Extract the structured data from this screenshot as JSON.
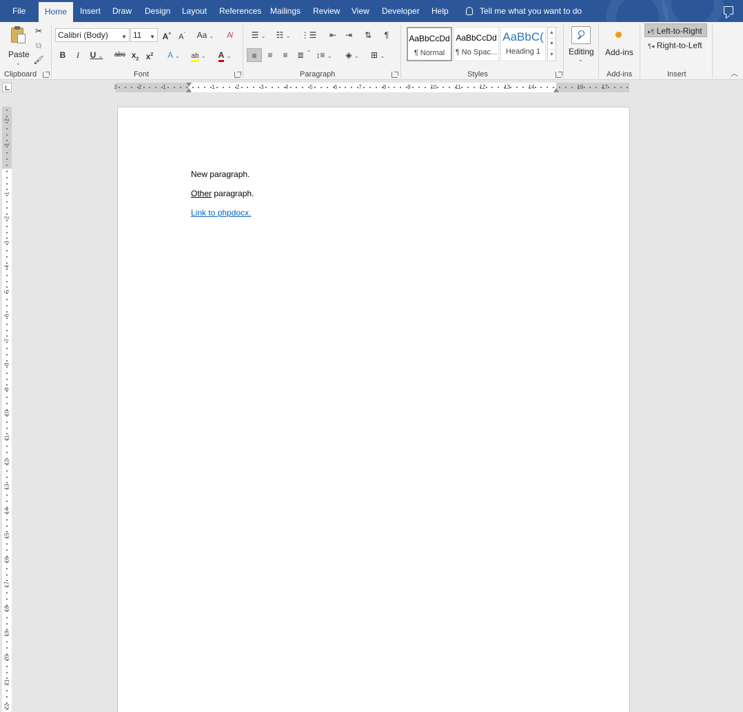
{
  "tabs": {
    "file": "File",
    "home": "Home",
    "insert": "Insert",
    "draw": "Draw",
    "design": "Design",
    "layout": "Layout",
    "references": "References",
    "mailings": "Mailings",
    "review": "Review",
    "view": "View",
    "developer": "Developer",
    "help": "Help"
  },
  "tell_me": "Tell me what you want to do",
  "clipboard": {
    "paste_label": "Paste",
    "group_label": "Clipboard"
  },
  "font": {
    "family": "Calibri (Body)",
    "size": "11",
    "group_label": "Font"
  },
  "paragraph": {
    "group_label": "Paragraph"
  },
  "styles": {
    "group_label": "Styles",
    "items": [
      {
        "preview": "AaBbCcDd",
        "name": "¶ Normal"
      },
      {
        "preview": "AaBbCcDd",
        "name": "¶ No Spac..."
      },
      {
        "preview": "AaBbC(",
        "name": "Heading 1"
      }
    ]
  },
  "editing": {
    "label": "Editing"
  },
  "addins": {
    "label": "Add-ins",
    "group_label": "Add-ins"
  },
  "insert_group": {
    "ltr": "Left-to-Right",
    "rtl": "Right-to-Left",
    "group_label": "Insert"
  },
  "ruler": {
    "h_left": [
      "3",
      "2",
      "1"
    ],
    "h_right": [
      "1",
      "2",
      "3",
      "4",
      "5",
      "6",
      "7",
      "8",
      "9",
      "10",
      "11",
      "12",
      "13",
      "14",
      "16",
      "17"
    ],
    "v_top": [
      "2",
      "1"
    ],
    "v_body": [
      "1",
      "2",
      "3",
      "4",
      "5",
      "6",
      "7",
      "8",
      "9",
      "10",
      "11",
      "12",
      "13",
      "14",
      "15",
      "16",
      "17",
      "18",
      "19",
      "20",
      "21",
      "22"
    ]
  },
  "document": {
    "para1": "New paragraph.",
    "para2_underlined": "Other",
    "para2_rest": " paragraph.",
    "link": "Link to phpdocx."
  },
  "colors": {
    "title_bar": "#2b579a",
    "link": "#0563c1",
    "heading": "#2e74b5"
  }
}
